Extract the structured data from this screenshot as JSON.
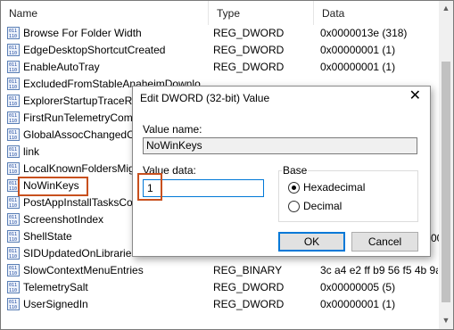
{
  "columns": {
    "name": "Name",
    "type": "Type",
    "data": "Data"
  },
  "rows": [
    {
      "name": "Browse For Folder Width",
      "type": "REG_DWORD",
      "data": "0x0000013e (318)"
    },
    {
      "name": "EdgeDesktopShortcutCreated",
      "type": "REG_DWORD",
      "data": "0x00000001 (1)"
    },
    {
      "name": "EnableAutoTray",
      "type": "REG_DWORD",
      "data": "0x00000001 (1)"
    },
    {
      "name": "ExcludedFromStableAnaheimDownlo",
      "type": "",
      "data": ""
    },
    {
      "name": "ExplorerStartupTraceRec",
      "type": "",
      "data": ""
    },
    {
      "name": "FirstRunTelemetryComp",
      "type": "",
      "data": ""
    },
    {
      "name": "GlobalAssocChangedCo",
      "type": "",
      "data": ""
    },
    {
      "name": "link",
      "type": "",
      "data": ""
    },
    {
      "name": "LocalKnownFoldersMig",
      "type": "",
      "data": ""
    },
    {
      "name": "NoWinKeys",
      "type": "",
      "data": ""
    },
    {
      "name": "PostAppInstallTasksCo",
      "type": "",
      "data": ""
    },
    {
      "name": "ScreenshotIndex",
      "type": "",
      "data": ""
    },
    {
      "name": "ShellState",
      "type": "",
      "data": ""
    },
    {
      "name": "SIDUpdatedOnLibraries",
      "type": "",
      "data": ""
    },
    {
      "name": "SlowContextMenuEntries",
      "type": "REG_BINARY",
      "data": "3c a4 e2 ff b9 56 f5 4b 9a"
    },
    {
      "name": "TelemetrySalt",
      "type": "REG_DWORD",
      "data": "0x00000005 (5)"
    },
    {
      "name": "UserSignedIn",
      "type": "REG_DWORD",
      "data": "0x00000001 (1)"
    }
  ],
  "shellstate_overflow": "00",
  "dialog": {
    "title": "Edit DWORD (32-bit) Value",
    "close_glyph": "✕",
    "value_name_label": "Value name:",
    "value_name": "NoWinKeys",
    "value_data_label": "Value data:",
    "value_data": "1",
    "base_label": "Base",
    "base_options": [
      {
        "label": "Hexadecimal",
        "selected": true
      },
      {
        "label": "Decimal",
        "selected": false
      }
    ],
    "ok_label": "OK",
    "cancel_label": "Cancel"
  },
  "icons": {
    "row_icon": "registry-binary-value-icon"
  },
  "colors": {
    "highlight_border": "#c8501e",
    "focus_blue": "#0078d7"
  }
}
